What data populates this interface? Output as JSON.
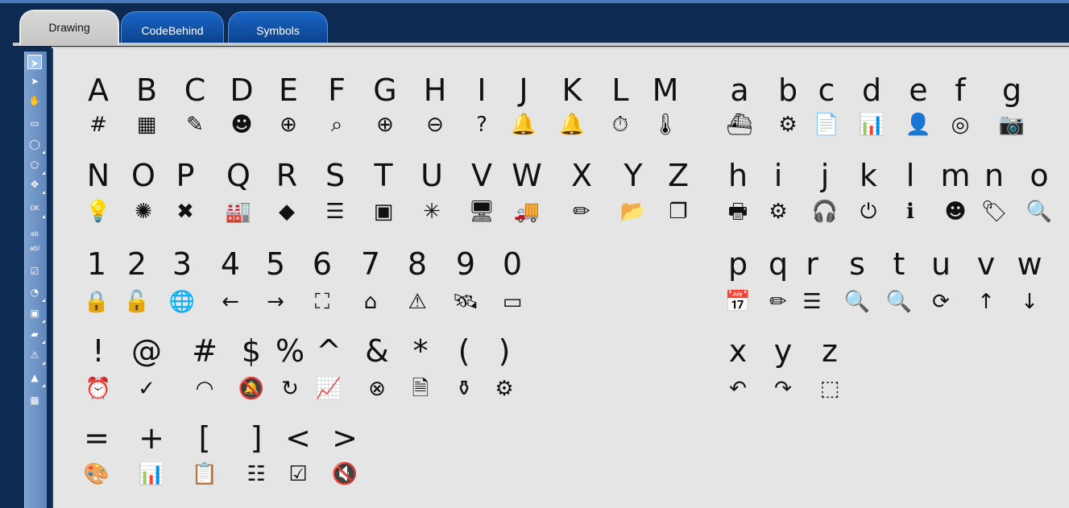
{
  "tabs": [
    {
      "label": "Drawing"
    },
    {
      "label": "CodeBehind"
    },
    {
      "label": "Symbols"
    }
  ],
  "toolbar": {
    "tools": [
      {
        "icon": "pointer-select-icon",
        "glyph": "⮞"
      },
      {
        "icon": "pointer-icon",
        "glyph": "➤"
      },
      {
        "icon": "hand-pan-icon",
        "glyph": "✋"
      },
      {
        "icon": "rectangle-icon",
        "glyph": "▭"
      },
      {
        "icon": "ellipse-icon",
        "glyph": "◯"
      },
      {
        "icon": "polygon-icon",
        "glyph": "⬠"
      },
      {
        "icon": "bezier-icon",
        "glyph": "✥"
      },
      {
        "icon": "button-icon",
        "glyph": "OK"
      },
      {
        "icon": "text-icon",
        "glyph": "ab"
      },
      {
        "icon": "textbox-icon",
        "glyph": "abl"
      },
      {
        "icon": "checkbox-icon",
        "glyph": "☑"
      },
      {
        "icon": "gauge-icon",
        "glyph": "◔"
      },
      {
        "icon": "image-icon",
        "glyph": "▣"
      },
      {
        "icon": "folder-icon",
        "glyph": "▰"
      },
      {
        "icon": "warning-icon",
        "glyph": "⚠"
      },
      {
        "icon": "chart-icon",
        "glyph": "▲"
      },
      {
        "icon": "grid-icon",
        "glyph": "▦"
      }
    ]
  },
  "rows": {
    "upper_letters": [
      "A",
      "B",
      "C",
      "D",
      "E",
      "F",
      "G",
      "H",
      "I",
      "J",
      "K",
      "L",
      "M"
    ],
    "upper_letters_icons": [
      {
        "name": "grid-hash-icon",
        "g": "#"
      },
      {
        "name": "table-icon",
        "g": "▦"
      },
      {
        "name": "edit-comment-icon",
        "g": "✎"
      },
      {
        "name": "comment-user-icon",
        "g": "☻"
      },
      {
        "name": "comment-add-icon",
        "g": "⊕"
      },
      {
        "name": "search-resize-icon",
        "g": "⌕"
      },
      {
        "name": "plus-circle-icon",
        "g": "⊕"
      },
      {
        "name": "minus-circle-icon",
        "g": "⊖"
      },
      {
        "name": "help-circle-icon",
        "g": "?"
      },
      {
        "name": "alarm-bell-filled-icon",
        "g": "🔔"
      },
      {
        "name": "alarm-bell-outline-icon",
        "g": "🔔"
      },
      {
        "name": "stopwatch-icon",
        "g": "⏱"
      },
      {
        "name": "thermometer-icon",
        "g": "🌡"
      }
    ],
    "upper_letters_2": [
      "N",
      "O",
      "P",
      "Q",
      "R",
      "S",
      "T",
      "U",
      "V",
      "W",
      "X",
      "Y",
      "Z"
    ],
    "upper_letters_2_icons": [
      {
        "name": "lightbulb-icon",
        "g": "💡"
      },
      {
        "name": "sun-gear-icon",
        "g": "✺"
      },
      {
        "name": "tools-icon",
        "g": "✖"
      },
      {
        "name": "factory-icon",
        "g": "🏭"
      },
      {
        "name": "widgets-icon",
        "g": "◆"
      },
      {
        "name": "checklist-icon",
        "g": "☰"
      },
      {
        "name": "chip-icon",
        "g": "▣"
      },
      {
        "name": "network-star-icon",
        "g": "✳"
      },
      {
        "name": "computer-copy-icon",
        "g": "🖥"
      },
      {
        "name": "truck-icon",
        "g": "🚚"
      },
      {
        "name": "ruler-pencil-icon",
        "g": "✏"
      },
      {
        "name": "folder-import-icon",
        "g": "📂"
      },
      {
        "name": "file-copy-icon",
        "g": "❐"
      }
    ],
    "numbers": [
      "1",
      "2",
      "3",
      "4",
      "5",
      "6",
      "7",
      "8",
      "9",
      "0"
    ],
    "numbers_icons": [
      {
        "name": "lock-closed-icon",
        "g": "🔒"
      },
      {
        "name": "lock-open-icon",
        "g": "🔓"
      },
      {
        "name": "globe-fingerprint-icon",
        "g": "🌐"
      },
      {
        "name": "arrow-left-circle-icon",
        "g": "←"
      },
      {
        "name": "arrow-right-circle-icon",
        "g": "→"
      },
      {
        "name": "fullscreen-icon",
        "g": "⛶"
      },
      {
        "name": "home-icon",
        "g": "⌂"
      },
      {
        "name": "warning-icon",
        "g": "⚠"
      },
      {
        "name": "satellite-icon",
        "g": "🛰"
      },
      {
        "name": "monitor-icon",
        "g": "▭"
      }
    ],
    "symbols": [
      "!",
      "@",
      "#",
      "$",
      "%",
      "^",
      "&",
      "*",
      "(",
      ")"
    ],
    "symbols_icons": [
      {
        "name": "alarm-clock-icon",
        "g": "⏰"
      },
      {
        "name": "check-circle-icon",
        "g": "✓"
      },
      {
        "name": "speedometer-icon",
        "g": "◠"
      },
      {
        "name": "bell-off-icon",
        "g": "🔕"
      },
      {
        "name": "refresh-icon",
        "g": "↻"
      },
      {
        "name": "line-chart-icon",
        "g": "📈"
      },
      {
        "name": "close-circle-icon",
        "g": "⊗"
      },
      {
        "name": "document-stack-icon",
        "g": "🗎"
      },
      {
        "name": "bottle-icon",
        "g": "⚱"
      },
      {
        "name": "settings-badge-icon",
        "g": "⚙"
      }
    ],
    "symbols_2": [
      "=",
      "+",
      "[",
      "]",
      "<",
      ">"
    ],
    "symbols_2_icons": [
      {
        "name": "palette-icon",
        "g": "🎨"
      },
      {
        "name": "bar-growth-icon",
        "g": "📊"
      },
      {
        "name": "clipboard-list-icon",
        "g": "📋"
      },
      {
        "name": "checklist-box-icon",
        "g": "☷"
      },
      {
        "name": "checkbox-checked-icon",
        "g": "☑"
      },
      {
        "name": "volume-mute-icon",
        "g": "🔇"
      }
    ],
    "lower_letters": [
      "a",
      "b",
      "c",
      "d",
      "e",
      "f",
      "g"
    ],
    "lower_letters_icons": [
      {
        "name": "oil-platform-icon",
        "g": "⛴"
      },
      {
        "name": "settings-circle-icon",
        "g": "⚙"
      },
      {
        "name": "document-chart-icon",
        "g": "📄"
      },
      {
        "name": "bar-chart-icon",
        "g": "📊"
      },
      {
        "name": "user-lock-icon",
        "g": "👤"
      },
      {
        "name": "radar-icon",
        "g": "◎"
      },
      {
        "name": "camera-icon",
        "g": "📷"
      }
    ],
    "lower_letters_2": [
      "h",
      "i",
      "j",
      "k",
      "l",
      "m",
      "n",
      "o"
    ],
    "lower_letters_2_icons": [
      {
        "name": "printer-icon",
        "g": "🖶"
      },
      {
        "name": "gear-icon",
        "g": "⚙"
      },
      {
        "name": "headset-icon",
        "g": "🎧"
      },
      {
        "name": "power-icon",
        "g": "⏻"
      },
      {
        "name": "info-icon",
        "g": "ℹ"
      },
      {
        "name": "head-gear-icon",
        "g": "☻"
      },
      {
        "name": "tags-icon",
        "g": "🏷"
      },
      {
        "name": "search-list-icon",
        "g": "🔍"
      }
    ],
    "lower_letters_3": [
      "p",
      "q",
      "r",
      "s",
      "t",
      "u",
      "v",
      "w"
    ],
    "lower_letters_3_icons": [
      {
        "name": "calendar-icon",
        "g": "📅"
      },
      {
        "name": "pencil-icon",
        "g": "✏"
      },
      {
        "name": "sort-list-icon",
        "g": "☰"
      },
      {
        "name": "zoom-in-icon",
        "g": "🔍"
      },
      {
        "name": "zoom-out-icon",
        "g": "🔍"
      },
      {
        "name": "sync-icon",
        "g": "⟳"
      },
      {
        "name": "arrow-up-circle-icon",
        "g": "↑"
      },
      {
        "name": "arrow-down-circle-icon",
        "g": "↓"
      }
    ],
    "lower_letters_4": [
      "x",
      "y",
      "z"
    ],
    "lower_letters_4_icons": [
      {
        "name": "undo-icon",
        "g": "↶"
      },
      {
        "name": "redo-icon",
        "g": "↷"
      },
      {
        "name": "select-shape-icon",
        "g": "⬚"
      }
    ]
  }
}
